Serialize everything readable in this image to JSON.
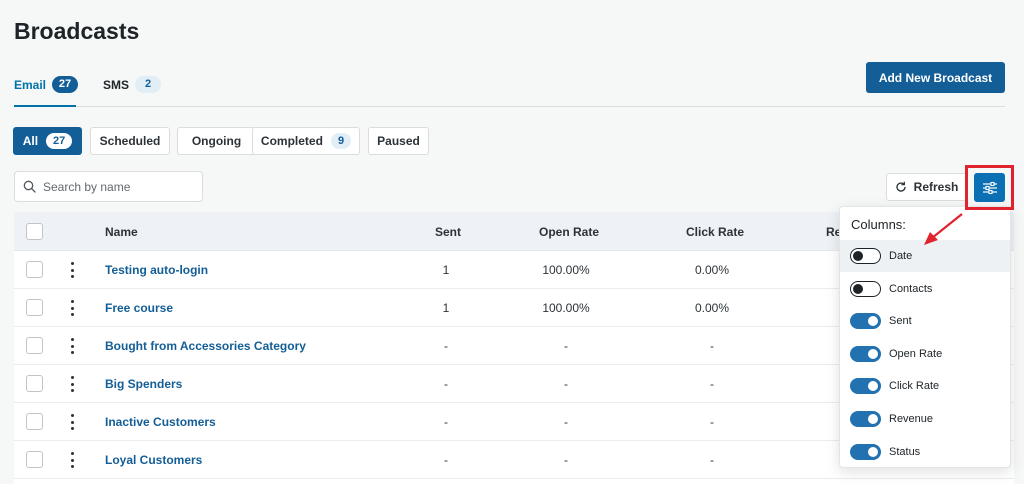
{
  "page": {
    "title": "Broadcasts"
  },
  "tabs": [
    {
      "label": "Email",
      "count": "27"
    },
    {
      "label": "SMS",
      "count": "2"
    }
  ],
  "add_button": "Add New Broadcast",
  "filters": [
    {
      "label": "All",
      "count": "27"
    },
    {
      "label": "Scheduled"
    },
    {
      "label": "Ongoing"
    },
    {
      "label": "Completed",
      "count": "9"
    },
    {
      "label": "Paused"
    }
  ],
  "search": {
    "placeholder": "Search by name",
    "icon": "search-icon"
  },
  "refresh_button": "Refresh",
  "table": {
    "headers": {
      "name": "Name",
      "sent": "Sent",
      "open_rate": "Open Rate",
      "click_rate": "Click Rate",
      "partial": "Re"
    },
    "rows": [
      {
        "name": "Testing auto-login",
        "sent": "1",
        "open_rate": "100.00%",
        "click_rate": "0.00%"
      },
      {
        "name": "Free course",
        "sent": "1",
        "open_rate": "100.00%",
        "click_rate": "0.00%"
      },
      {
        "name": "Bought from Accessories Category",
        "sent": "-",
        "open_rate": "-",
        "click_rate": "-"
      },
      {
        "name": "Big Spenders",
        "sent": "-",
        "open_rate": "-",
        "click_rate": "-"
      },
      {
        "name": "Inactive Customers",
        "sent": "-",
        "open_rate": "-",
        "click_rate": "-"
      },
      {
        "name": "Loyal Customers",
        "sent": "-",
        "open_rate": "-",
        "click_rate": "-"
      }
    ]
  },
  "columns_menu": {
    "title": "Columns:",
    "options": [
      {
        "label": "Date",
        "enabled": false
      },
      {
        "label": "Contacts",
        "enabled": false
      },
      {
        "label": "Sent",
        "enabled": true
      },
      {
        "label": "Open Rate",
        "enabled": true
      },
      {
        "label": "Click Rate",
        "enabled": true
      },
      {
        "label": "Revenue",
        "enabled": true
      },
      {
        "label": "Status",
        "enabled": true
      }
    ]
  },
  "colors": {
    "primary": "#135e96",
    "link": "#0073aa",
    "highlight_box": "#e0232e",
    "toggle_on": "#2271b1"
  }
}
